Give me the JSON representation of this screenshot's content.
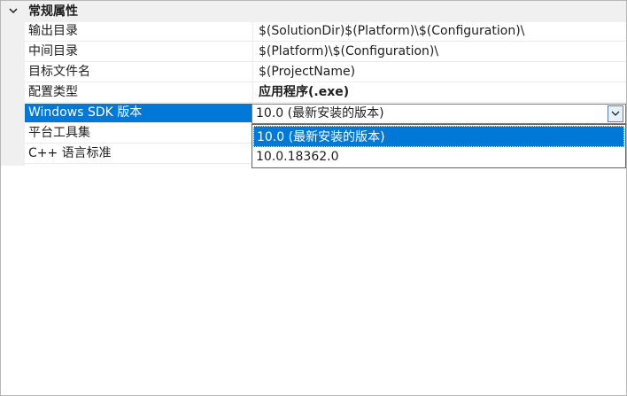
{
  "category": {
    "label": "常规属性"
  },
  "properties": [
    {
      "name": "输出目录",
      "value": "$(SolutionDir)$(Platform)\\$(Configuration)\\"
    },
    {
      "name": "中间目录",
      "value": "$(Platform)\\$(Configuration)\\"
    },
    {
      "name": "目标文件名",
      "value": "$(ProjectName)"
    },
    {
      "name": "配置类型",
      "value": "应用程序(.exe)"
    },
    {
      "name": "Windows SDK 版本",
      "value": ""
    },
    {
      "name": "平台工具集",
      "value": ""
    },
    {
      "name": "C++ 语言标准",
      "value": ""
    }
  ],
  "sdk_combo": {
    "selected": "10.0 (最新安装的版本)",
    "options": [
      "10.0 (最新安装的版本)",
      "10.0.18362.0"
    ]
  },
  "colors": {
    "selection": "#0078d7",
    "category_bg": "#f0f0f0"
  }
}
